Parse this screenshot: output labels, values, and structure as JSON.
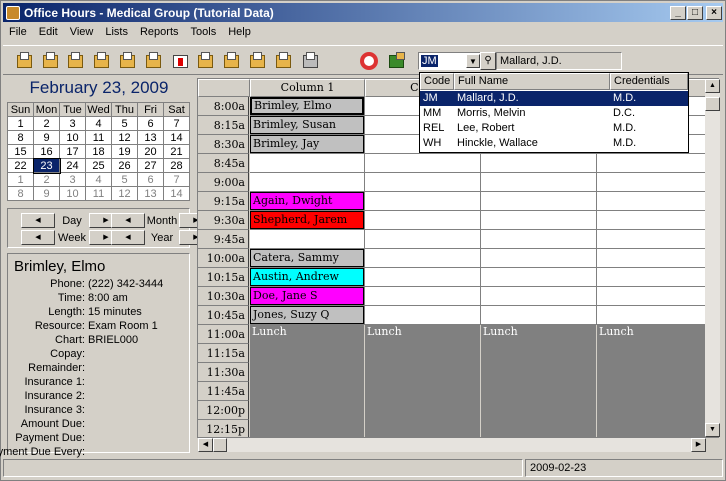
{
  "window": {
    "title": "Office Hours - Medical Group (Tutorial Data)"
  },
  "menu": [
    "File",
    "Edit",
    "View",
    "Lists",
    "Reports",
    "Tools",
    "Help"
  ],
  "toolbar": {
    "icons": [
      "calendar-icon",
      "calendar-icon",
      "calendar-icon",
      "calendar-icon",
      "book-icon",
      "book-icon",
      "medical-kit-icon",
      "book-icon",
      "book-icon",
      "book-icon",
      "book-icon",
      "printer-icon",
      "help-lifebuoy-icon",
      "exit-door-icon"
    ],
    "code_value": "JM",
    "selected_name": "Mallard, J.D."
  },
  "calendar": {
    "header": "February 23, 2009",
    "weekdays": [
      "Sun",
      "Mon",
      "Tue",
      "Wed",
      "Thu",
      "Fri",
      "Sat"
    ],
    "weeks": [
      [
        "1",
        "2",
        "3",
        "4",
        "5",
        "6",
        "7"
      ],
      [
        "8",
        "9",
        "10",
        "11",
        "12",
        "13",
        "14"
      ],
      [
        "15",
        "16",
        "17",
        "18",
        "19",
        "20",
        "21"
      ],
      [
        "22",
        "23",
        "24",
        "25",
        "26",
        "27",
        "28"
      ],
      [
        "1",
        "2",
        "3",
        "4",
        "5",
        "6",
        "7"
      ],
      [
        "8",
        "9",
        "10",
        "11",
        "12",
        "13",
        "14"
      ]
    ],
    "selected": "23"
  },
  "nav": {
    "day": "Day",
    "week": "Week",
    "month": "Month",
    "year": "Year"
  },
  "details": {
    "name": "Brimley, Elmo",
    "fields": [
      {
        "label": "Phone:",
        "value": "(222) 342-3444"
      },
      {
        "label": "Time:",
        "value": "8:00 am"
      },
      {
        "label": "Length:",
        "value": "15 minutes"
      },
      {
        "label": "Resource:",
        "value": "Exam Room 1"
      },
      {
        "label": "Chart:",
        "value": "BRIEL000"
      },
      {
        "label": "Copay:",
        "value": ""
      },
      {
        "label": "Remainder:",
        "value": ""
      },
      {
        "label": "Insurance 1:",
        "value": ""
      },
      {
        "label": "Insurance 2:",
        "value": ""
      },
      {
        "label": "Insurance 3:",
        "value": ""
      },
      {
        "label": "Amount Due:",
        "value": ""
      },
      {
        "label": "Payment Due:",
        "value": ""
      },
      {
        "label": "Payment Due Every:",
        "value": ""
      }
    ]
  },
  "schedule": {
    "columns": [
      "Column 1",
      "Colu",
      "",
      ""
    ],
    "times": [
      "8:00a",
      "8:15a",
      "8:30a",
      "8:45a",
      "9:00a",
      "9:15a",
      "9:30a",
      "9:45a",
      "10:00a",
      "10:15a",
      "10:30a",
      "10:45a",
      "11:00a",
      "11:15a",
      "11:30a",
      "11:45a",
      "12:00p",
      "12:15p"
    ],
    "appointments": [
      {
        "slot": 0,
        "name": "Brimley, Elmo",
        "color": "#c0c0c0"
      },
      {
        "slot": 1,
        "name": "Brimley, Susan",
        "color": "#c0c0c0"
      },
      {
        "slot": 2,
        "name": "Brimley, Jay",
        "color": "#c0c0c0"
      },
      {
        "slot": 5,
        "name": "Again, Dwight",
        "color": "#ff00ff"
      },
      {
        "slot": 6,
        "name": "Shepherd, Jarem",
        "color": "#ff0000"
      },
      {
        "slot": 8,
        "name": "Catera, Sammy",
        "color": "#c0c0c0"
      },
      {
        "slot": 9,
        "name": "Austin, Andrew",
        "color": "#00ffff"
      },
      {
        "slot": 10,
        "name": "Doe, Jane S",
        "color": "#ff00ff"
      },
      {
        "slot": 11,
        "name": "Jones, Suzy Q",
        "color": "#c0c0c0"
      }
    ],
    "lunch_label": "Lunch"
  },
  "popup": {
    "headers": [
      "Code",
      "Full Name",
      "Credentials"
    ],
    "rows": [
      {
        "code": "JM",
        "name": "Mallard, J.D.",
        "cred": "M.D."
      },
      {
        "code": "MM",
        "name": "Morris, Melvin",
        "cred": "D.C."
      },
      {
        "code": "REL",
        "name": "Lee, Robert",
        "cred": "M.D."
      },
      {
        "code": "WH",
        "name": "Hinckle, Wallace",
        "cred": "M.D."
      }
    ],
    "selected_index": 0
  },
  "status": {
    "date": "2009-02-23"
  }
}
